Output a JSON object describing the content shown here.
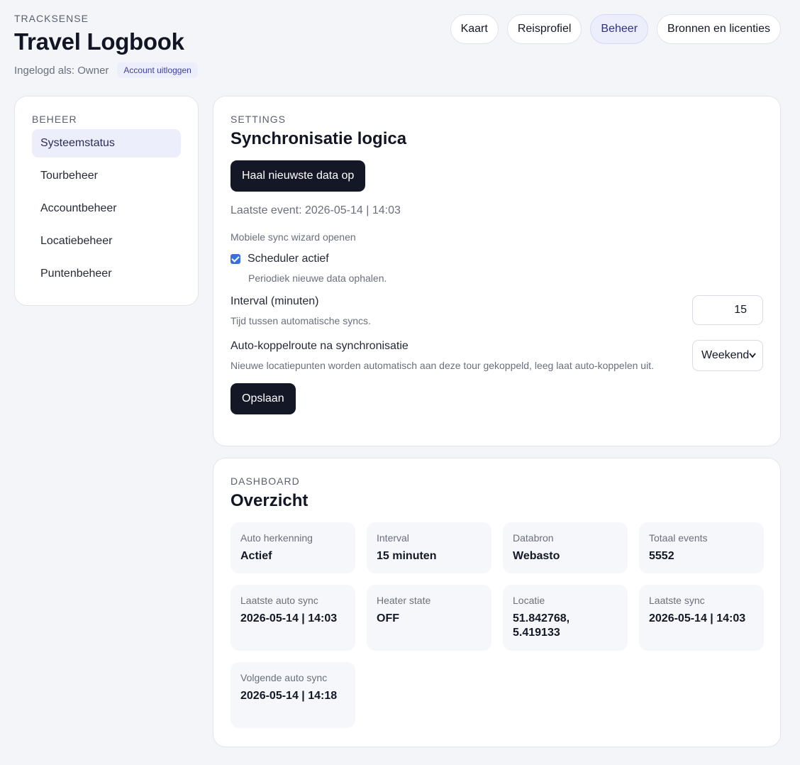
{
  "brand": {
    "eyebrow": "TRACKSENSE",
    "title": "Travel Logbook",
    "logged_in": "Ingelogd als: Owner",
    "logout": "Account uitloggen"
  },
  "topnav": {
    "items": [
      "Kaart",
      "Reisprofiel",
      "Beheer",
      "Bronnen en licenties"
    ],
    "active": "Beheer"
  },
  "sidebar": {
    "eyebrow": "BEHEER",
    "items": [
      "Systeemstatus",
      "Tourbeheer",
      "Accountbeheer",
      "Locatiebeheer",
      "Puntenbeheer"
    ],
    "active": "Systeemstatus"
  },
  "settings": {
    "eyebrow": "SETTINGS",
    "title": "Synchronisatie logica",
    "fetch_button": "Haal nieuwste data op",
    "last_event": "Laatste event: 2026-05-14 | 14:03",
    "wizard_link": "Mobiele sync wizard openen",
    "scheduler": {
      "label": "Scheduler actief",
      "checked": true,
      "helper": "Periodiek nieuwe data ophalen."
    },
    "interval": {
      "label": "Interval (minuten)",
      "helper": "Tijd tussen automatische syncs.",
      "value": "15"
    },
    "autoroute": {
      "label": "Auto-koppelroute na synchronisatie",
      "helper": "Nieuwe locatiepunten worden automatisch aan deze tour gekoppeld, leeg laat auto-koppelen uit.",
      "selected": "Weekend"
    },
    "save_button": "Opslaan"
  },
  "dashboard": {
    "eyebrow": "DASHBOARD",
    "title": "Overzicht",
    "stats": {
      "auto_recognition": {
        "label": "Auto herkenning",
        "value": "Actief"
      },
      "interval": {
        "label": "Interval",
        "value": "15 minuten"
      },
      "source": {
        "label": "Databron",
        "value": "Webasto"
      },
      "total_events": {
        "label": "Totaal events",
        "value": "5552"
      },
      "last_auto_sync": {
        "label": "Laatste auto sync",
        "value": "2026-05-14 | 14:03"
      },
      "heater_state": {
        "label": "Heater state",
        "value": "OFF"
      },
      "location": {
        "label": "Locatie",
        "value": "51.842768, 5.419133"
      },
      "last_sync": {
        "label": "Laatste sync",
        "value": "2026-05-14 | 14:03"
      },
      "next_auto_sync": {
        "label": "Volgende auto sync",
        "value": "2026-05-14 | 14:18"
      }
    }
  }
}
